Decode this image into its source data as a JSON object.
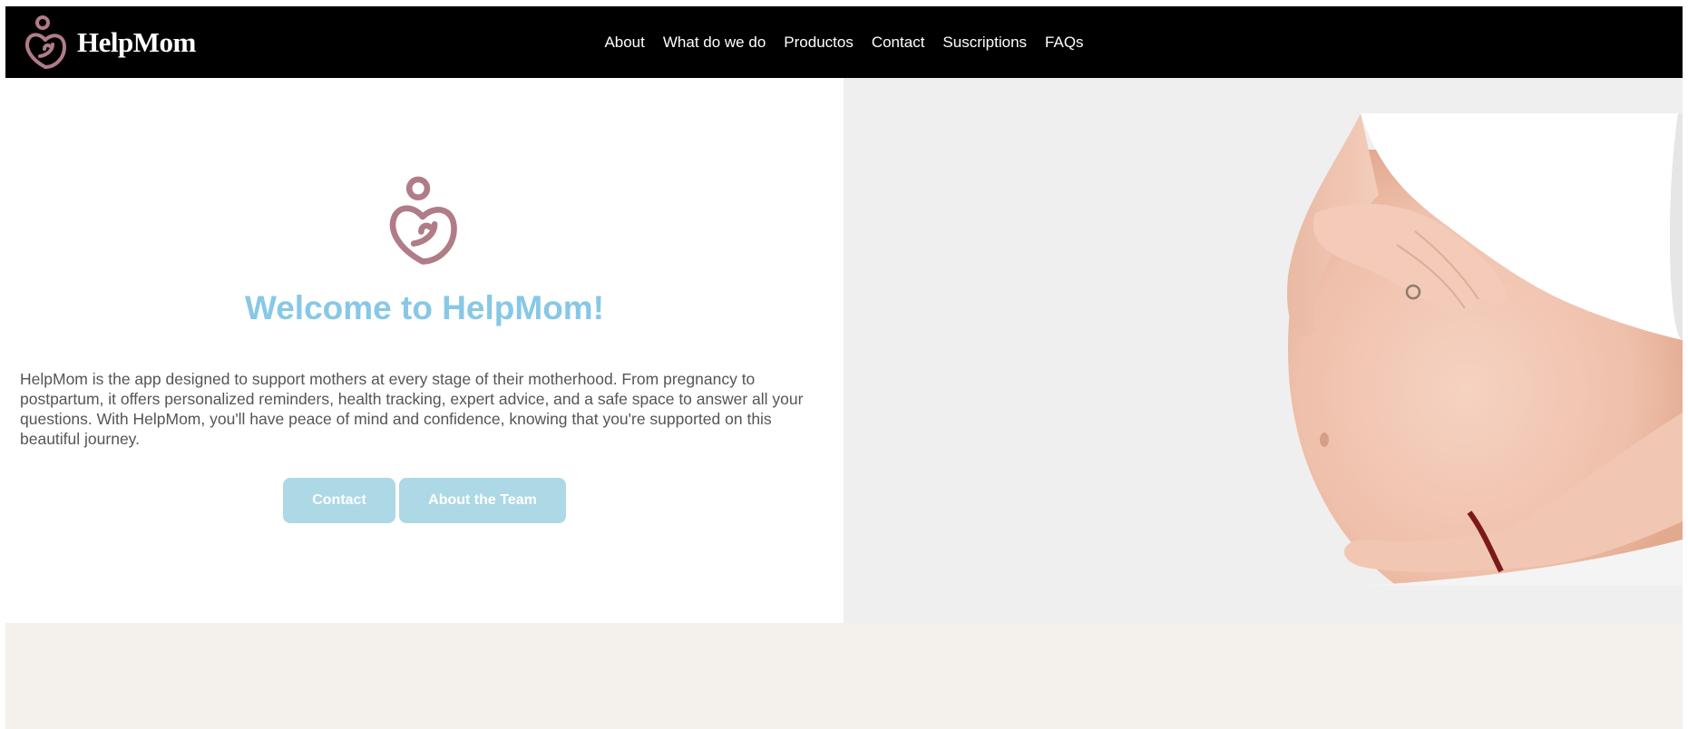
{
  "brand": {
    "name": "HelpMom",
    "logo_icon": "mother-child-heart-icon"
  },
  "nav": {
    "items": [
      {
        "label": "About"
      },
      {
        "label": "What do we do"
      },
      {
        "label": "Productos"
      },
      {
        "label": "Contact"
      },
      {
        "label": "Suscriptions"
      },
      {
        "label": "FAQs"
      }
    ]
  },
  "hero": {
    "icon": "mother-child-heart-icon",
    "title": "Welcome to HelpMom!",
    "description": "HelpMom is the app designed to support mothers at every stage of their motherhood. From pregnancy to postpartum, it offers personalized reminders, health tracking, expert advice, and a safe space to answer all your questions. With HelpMom, you'll have peace of mind and confidence, knowing that you're supported on this beautiful journey.",
    "buttons": {
      "contact": "Contact",
      "about_team": "About the Team"
    },
    "image": "pregnant-belly-photo"
  },
  "colors": {
    "navbar_bg": "#000000",
    "logo": "#b07c87",
    "title": "#87c8e6",
    "button_bg": "#add8e6",
    "text": "#555555",
    "image_panel_bg": "#efefef",
    "footer_band": "#f4f1ed"
  }
}
